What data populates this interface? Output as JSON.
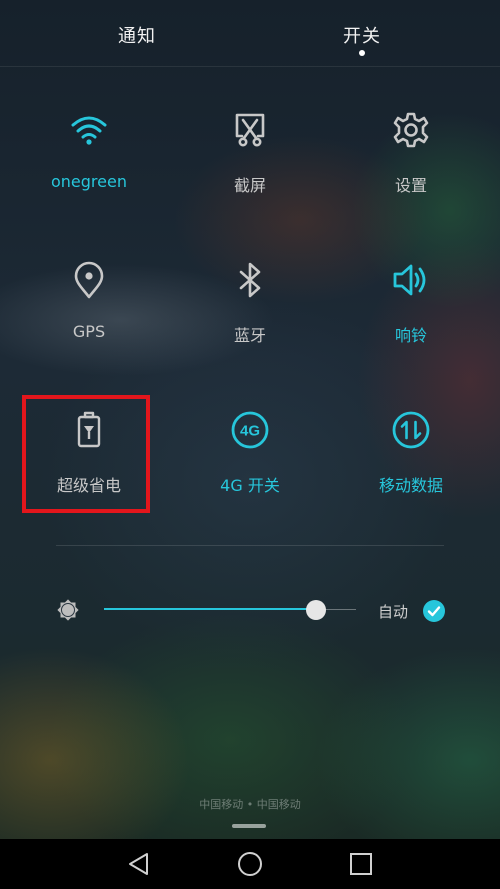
{
  "colors": {
    "accent": "#27c6db",
    "inactive": "#c8c8c8",
    "highlight": "#e3161c"
  },
  "tabs": {
    "notifications": "通知",
    "switches": "开关"
  },
  "toggles": [
    {
      "label": "onegreen",
      "icon": "wifi-icon",
      "active": true
    },
    {
      "label": "截屏",
      "icon": "screenshot-icon",
      "active": false
    },
    {
      "label": "设置",
      "icon": "gear-icon",
      "active": false
    },
    {
      "label": "GPS",
      "icon": "location-pin-icon",
      "active": false
    },
    {
      "label": "蓝牙",
      "icon": "bluetooth-icon",
      "active": false
    },
    {
      "label": "响铃",
      "icon": "speaker-icon",
      "active": true
    },
    {
      "label": "超级省电",
      "icon": "power-saver-battery-icon",
      "active": false
    },
    {
      "label": "4G 开关",
      "icon": "4g-icon",
      "active": true
    },
    {
      "label": "移动数据",
      "icon": "mobile-data-icon",
      "active": true
    }
  ],
  "brightness": {
    "level": 0.84,
    "auto_label": "自动",
    "auto_checked": true
  },
  "carrier_text": "中国移动 • 中国移动",
  "navbar": {
    "buttons": [
      "back-icon",
      "home-icon",
      "recent-apps-icon"
    ]
  }
}
